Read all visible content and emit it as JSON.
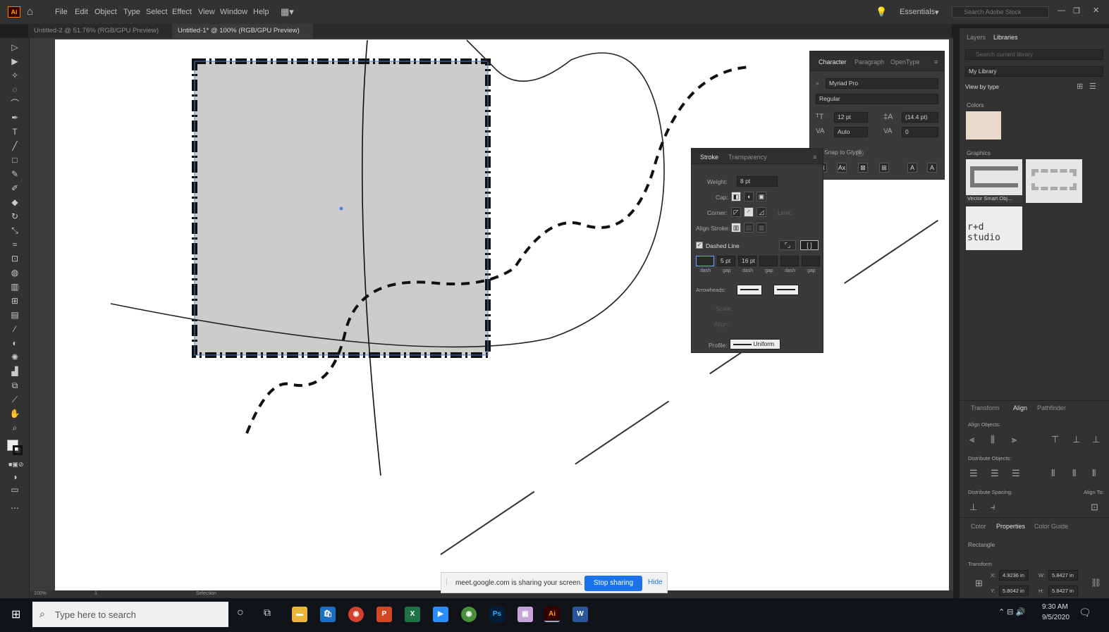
{
  "app": {
    "logo": "Ai",
    "workspace": "Essentials",
    "search_placeholder": "Search Adobe Stock"
  },
  "menu": [
    "File",
    "Edit",
    "Object",
    "Type",
    "Select",
    "Effect",
    "View",
    "Window",
    "Help"
  ],
  "doc_tabs": [
    {
      "label": "Untitled-2 @ 51.76% (RGB/GPU Preview)"
    },
    {
      "label": "Untitled-1* @ 100% (RGB/GPU Preview)"
    }
  ],
  "character_panel": {
    "tabs": [
      "Character",
      "Paragraph",
      "OpenType"
    ],
    "font": "Myriad Pro",
    "style": "Regular",
    "size": "12 pt",
    "leading": "(14.4 pt)",
    "kerning": "Auto",
    "tracking": "0",
    "snap": "Snap to Glyph"
  },
  "stroke_panel": {
    "tabs": [
      "Stroke",
      "Transparency"
    ],
    "weight_label": "Weight:",
    "weight": "8 pt",
    "cap_label": "Cap:",
    "corner_label": "Corner:",
    "limit_label": "Limit:",
    "align_label": "Align Stroke:",
    "dashed_label": "Dashed Line",
    "dash_values": [
      "",
      "5 pt",
      "16 pt",
      "",
      "",
      ""
    ],
    "dash_labels": [
      "dash",
      "gap",
      "dash",
      "gap",
      "dash",
      "gap"
    ],
    "arrowheads_label": "Arrowheads:",
    "scale_label": "Scale:",
    "align_arrow_label": "Align:",
    "profile_label": "Profile:",
    "profile_value": "Uniform"
  },
  "libraries": {
    "tabs": [
      "Layers",
      "Libraries"
    ],
    "search_placeholder": "Search current library",
    "library_name": "My Library",
    "view_by": "View by type",
    "colors_heading": "Colors",
    "graphics_heading": "Graphics",
    "graphic_caption": "Vector Smart Obj...",
    "studio_text": "r+d studio",
    "swatch_color": "#e8d9c8"
  },
  "align_panel": {
    "tabs": [
      "Transform",
      "Align",
      "Pathfinder"
    ],
    "align_objects": "Align Objects:",
    "distribute_objects": "Distribute Objects:",
    "distribute_spacing": "Distribute Spacing:",
    "align_to": "Align To:"
  },
  "properties_panel": {
    "tabs": [
      "Color",
      "Properties",
      "Color Guide"
    ],
    "object_type": "Rectangle",
    "transform_heading": "Transform",
    "x": "4.9236 in",
    "y": "5.8042 in",
    "w": "5.8427 in",
    "h": "5.8427 in"
  },
  "statusbar": {
    "zoom": "100%",
    "page": "1",
    "tool": "Selection"
  },
  "share_bar": {
    "message": "meet.google.com is sharing your screen.",
    "stop": "Stop sharing",
    "hide": "Hide"
  },
  "taskbar": {
    "search_placeholder": "Type here to search",
    "time": "9:30 AM",
    "date": "9/5/2020"
  }
}
